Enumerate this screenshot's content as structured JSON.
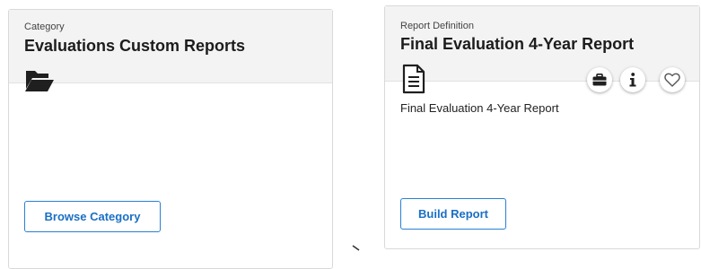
{
  "category_card": {
    "kicker": "Category",
    "title": "Evaluations Custom Reports",
    "icon": "folder-open-icon",
    "button_label": "Browse Category"
  },
  "report_card": {
    "kicker": "Report Definition",
    "title": "Final Evaluation 4-Year Report",
    "icon": "document-icon",
    "description": "Final Evaluation 4-Year Report",
    "button_label": "Build Report",
    "actions": [
      "briefcase-icon",
      "info-icon",
      "heart-icon"
    ]
  },
  "colors": {
    "accent": "#2a7fd4",
    "header_bg": "#f3f3f3",
    "border": "#d9d9d9"
  }
}
